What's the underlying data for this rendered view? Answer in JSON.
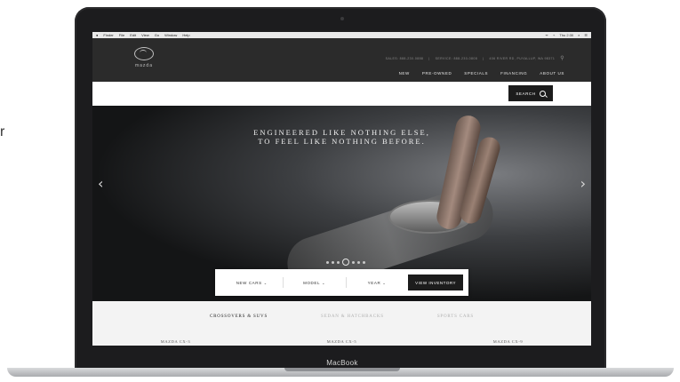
{
  "background_fragment": "r",
  "device": {
    "brand_label": "MacBook"
  },
  "menubar": {
    "items": [
      "Finder",
      "File",
      "Edit",
      "View",
      "Go",
      "Window",
      "Help"
    ],
    "right": [
      "ᯤ",
      "⌁",
      "Thu 2:30",
      "⌕",
      "☰"
    ]
  },
  "header": {
    "logo_word": "mazda",
    "contact": {
      "sales": "SALES: 888-230-0888",
      "service": "SERVICE: 888-230-0808",
      "address": "406 RIVER RD, PUYALLUP, WA 98371"
    },
    "nav": [
      "NEW",
      "PRE-OWNED",
      "SPECIALS",
      "FINANCING",
      "ABOUT US"
    ]
  },
  "search": {
    "button_label": "SEARCH"
  },
  "hero": {
    "headline_line1": "ENGINEERED LIKE NOTHING ELSE,",
    "headline_line2": "TO FEEL LIKE NOTHING BEFORE.",
    "prev_arrow": "‹",
    "next_arrow": "›"
  },
  "filters": {
    "items": [
      "NEW CARS",
      "MODEL",
      "YEAR"
    ],
    "button_label": "VIEW INVENTORY"
  },
  "categories": {
    "tabs": [
      "CROSSOVERS & SUVS",
      "SEDAN & HATCHBACKS",
      "SPORTS CARS"
    ],
    "active_index": 0
  },
  "models": [
    "MAZDA CX-3",
    "MAZDA CX-5",
    "MAZDA CX-9"
  ]
}
